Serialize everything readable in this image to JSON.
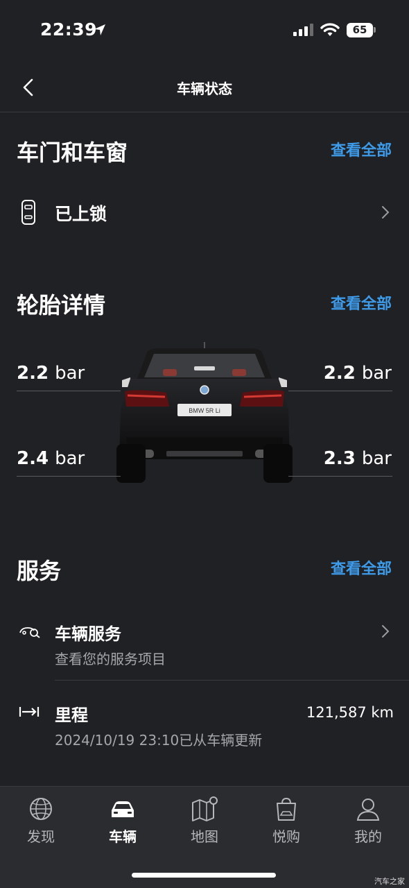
{
  "status_bar": {
    "time": "22:39",
    "battery": "65"
  },
  "header": {
    "title": "车辆状态"
  },
  "doors_windows": {
    "title": "车门和车窗",
    "view_all": "查看全部",
    "status": "已上锁"
  },
  "tires": {
    "title": "轮胎详情",
    "view_all": "查看全部",
    "front_left": {
      "value": "2.2",
      "unit": "bar"
    },
    "front_right": {
      "value": "2.2",
      "unit": "bar"
    },
    "rear_left": {
      "value": "2.4",
      "unit": "bar"
    },
    "rear_right": {
      "value": "2.3",
      "unit": "bar"
    },
    "car_plate": "BMW 5R Li"
  },
  "services": {
    "title": "服务",
    "view_all": "查看全部",
    "vehicle_service": {
      "title": "车辆服务",
      "subtitle": "查看您的服务项目"
    },
    "mileage": {
      "title": "里程",
      "subtitle": "2024/10/19 23:10已从车辆更新",
      "value": "121,587 km"
    }
  },
  "tab_bar": {
    "tabs": [
      {
        "label": "发现",
        "icon": "globe-icon",
        "active": false
      },
      {
        "label": "车辆",
        "icon": "car-icon",
        "active": true
      },
      {
        "label": "地图",
        "icon": "map-icon",
        "active": false
      },
      {
        "label": "悦购",
        "icon": "shopping-bag-icon",
        "active": false
      },
      {
        "label": "我的",
        "icon": "user-icon",
        "active": false
      }
    ]
  },
  "watermark": "汽车之家",
  "colors": {
    "background": "#202124",
    "accent": "#3d9be9",
    "tab_bar": "#2b2c2f"
  }
}
